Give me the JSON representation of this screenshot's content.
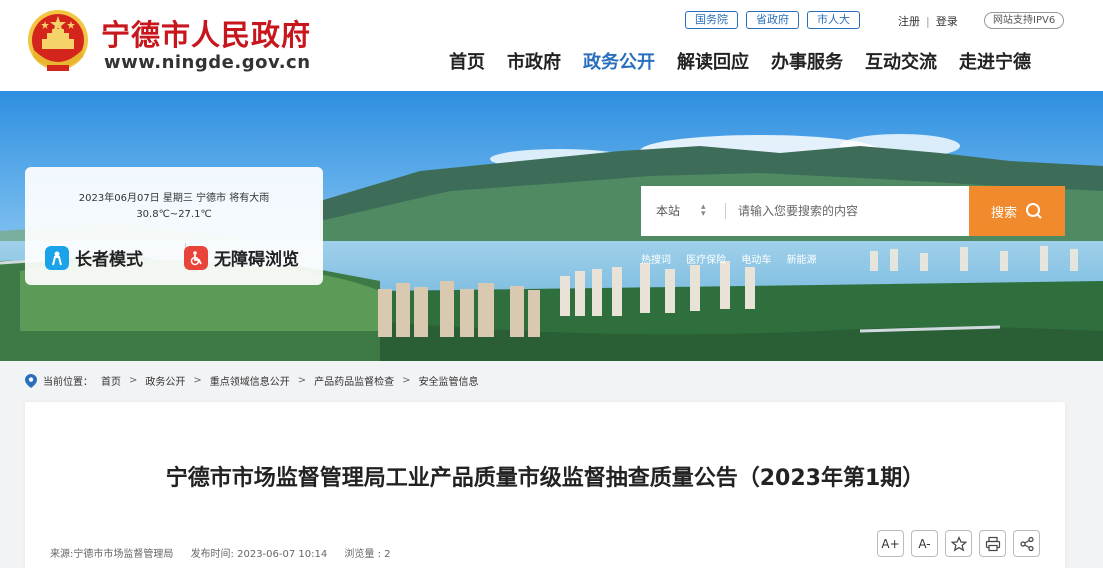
{
  "header": {
    "site_name": "宁德市人民政府",
    "site_url": "www.ningde.gov.cn",
    "top_links": [
      "国务院",
      "省政府",
      "市人大"
    ],
    "register": "注册",
    "login": "登录",
    "ipv6": "网站支持IPV6",
    "nav": [
      {
        "label": "首页",
        "active": false
      },
      {
        "label": "市政府",
        "active": false
      },
      {
        "label": "政务公开",
        "active": true
      },
      {
        "label": "解读回应",
        "active": false
      },
      {
        "label": "办事服务",
        "active": false
      },
      {
        "label": "互动交流",
        "active": false
      },
      {
        "label": "走进宁德",
        "active": false
      }
    ]
  },
  "weather": {
    "line1": "2023年06月07日 星期三 宁德市 将有大雨",
    "line2": "30.8℃~27.1℃",
    "elder_mode": "长者模式",
    "accessible": "无障碍浏览"
  },
  "search": {
    "scope": "本站",
    "placeholder": "请输入您要搜索的内容",
    "button": "搜索",
    "hot_words": [
      "热搜词",
      "医疗保险",
      "电动车",
      "新能源"
    ]
  },
  "breadcrumb": {
    "label": "当前位置：",
    "items": [
      "首页",
      "政务公开",
      "重点领域信息公开",
      "产品药品监督检查",
      "安全监管信息"
    ]
  },
  "article": {
    "title": "宁德市市场监督管理局工业产品质量市级监督抽查质量公告（2023年第1期）",
    "source": "来源:宁德市市场监督管理局",
    "publish_time": "发布时间: 2023-06-07 10:14",
    "views": "浏览量 : 2",
    "tools": [
      "A+",
      "A-",
      "star-icon",
      "print-icon",
      "share-icon"
    ]
  },
  "colors": {
    "brand_red": "#c8161d",
    "accent_blue": "#2a6fbd",
    "search_orange": "#f08a2c"
  }
}
